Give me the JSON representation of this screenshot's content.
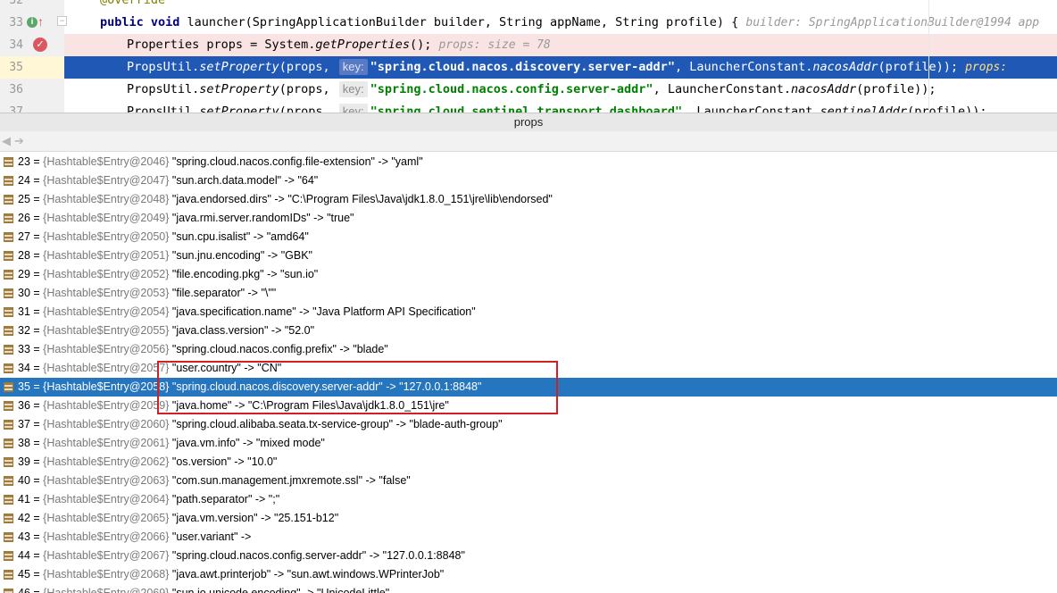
{
  "editor": {
    "lines": [
      {
        "num": "32",
        "text": "@Override"
      },
      {
        "num": "33",
        "kw1": "public void",
        "method": "launcher",
        "params": "(SpringApplicationBuilder builder, String appName, String profile) {",
        "hint": "builder: SpringApplicationBuilder@1994  app"
      },
      {
        "num": "34",
        "pre": "Properties props = System.",
        "call": "getProperties",
        "post": "();",
        "hint": "props:  size = 78"
      },
      {
        "num": "35",
        "pre": "PropsUtil.",
        "call": "setProperty",
        "mid": "(props,",
        "chip": "key:",
        "str": "\"spring.cloud.nacos.discovery.server-addr\"",
        "post": ", LauncherConstant.",
        "call2": "nacosAddr",
        "post2": "(profile));",
        "hint": "props:"
      },
      {
        "num": "36",
        "pre": "PropsUtil.",
        "call": "setProperty",
        "mid": "(props,",
        "chip": "key:",
        "str": "\"spring.cloud.nacos.config.server-addr\"",
        "post": ", LauncherConstant.",
        "call2": "nacosAddr",
        "post2": "(profile));"
      },
      {
        "num": "37",
        "pre": "PropsUtil.",
        "call": "setProperty",
        "mid": "(props,",
        "chip": "key:",
        "str": "\"spring.cloud.sentinel.transport.dashboard\"",
        "post": ", LauncherConstant.",
        "call2": "sentinelAddr",
        "post2": "(profile));"
      }
    ]
  },
  "panel": {
    "title": "props",
    "back_icon": "arrow-left-icon",
    "forward_icon": "arrow-right-icon"
  },
  "entries": [
    {
      "index": "23",
      "ref": "{Hashtable$Entry@2046}",
      "kv": "\"spring.cloud.nacos.config.file-extension\" -> \"yaml\""
    },
    {
      "index": "24",
      "ref": "{Hashtable$Entry@2047}",
      "kv": "\"sun.arch.data.model\" -> \"64\""
    },
    {
      "index": "25",
      "ref": "{Hashtable$Entry@2048}",
      "kv": "\"java.endorsed.dirs\" -> \"C:\\Program Files\\Java\\jdk1.8.0_151\\jre\\lib\\endorsed\""
    },
    {
      "index": "26",
      "ref": "{Hashtable$Entry@2049}",
      "kv": "\"java.rmi.server.randomIDs\" -> \"true\""
    },
    {
      "index": "27",
      "ref": "{Hashtable$Entry@2050}",
      "kv": "\"sun.cpu.isalist\" -> \"amd64\""
    },
    {
      "index": "28",
      "ref": "{Hashtable$Entry@2051}",
      "kv": "\"sun.jnu.encoding\" -> \"GBK\""
    },
    {
      "index": "29",
      "ref": "{Hashtable$Entry@2052}",
      "kv": "\"file.encoding.pkg\" -> \"sun.io\""
    },
    {
      "index": "30",
      "ref": "{Hashtable$Entry@2053}",
      "kv": "\"file.separator\" -> \"\\\"\""
    },
    {
      "index": "31",
      "ref": "{Hashtable$Entry@2054}",
      "kv": "\"java.specification.name\" -> \"Java Platform API Specification\""
    },
    {
      "index": "32",
      "ref": "{Hashtable$Entry@2055}",
      "kv": "\"java.class.version\" -> \"52.0\""
    },
    {
      "index": "33",
      "ref": "{Hashtable$Entry@2056}",
      "kv": "\"spring.cloud.nacos.config.prefix\" -> \"blade\""
    },
    {
      "index": "34",
      "ref": "{Hashtable$Entry@2057}",
      "kv": "\"user.country\" -> \"CN\""
    },
    {
      "index": "35",
      "ref": "{Hashtable$Entry@2058}",
      "kv": "\"spring.cloud.nacos.discovery.server-addr\" -> \"127.0.0.1:8848\""
    },
    {
      "index": "36",
      "ref": "{Hashtable$Entry@2059}",
      "kv": "\"java.home\" -> \"C:\\Program Files\\Java\\jdk1.8.0_151\\jre\""
    },
    {
      "index": "37",
      "ref": "{Hashtable$Entry@2060}",
      "kv": "\"spring.cloud.alibaba.seata.tx-service-group\" -> \"blade-auth-group\""
    },
    {
      "index": "38",
      "ref": "{Hashtable$Entry@2061}",
      "kv": "\"java.vm.info\" -> \"mixed mode\""
    },
    {
      "index": "39",
      "ref": "{Hashtable$Entry@2062}",
      "kv": "\"os.version\" -> \"10.0\""
    },
    {
      "index": "40",
      "ref": "{Hashtable$Entry@2063}",
      "kv": "\"com.sun.management.jmxremote.ssl\" -> \"false\""
    },
    {
      "index": "41",
      "ref": "{Hashtable$Entry@2064}",
      "kv": "\"path.separator\" -> \";\""
    },
    {
      "index": "42",
      "ref": "{Hashtable$Entry@2065}",
      "kv": "\"java.vm.version\" -> \"25.151-b12\""
    },
    {
      "index": "43",
      "ref": "{Hashtable$Entry@2066}",
      "kv": "\"user.variant\" ->"
    },
    {
      "index": "44",
      "ref": "{Hashtable$Entry@2067}",
      "kv": "\"spring.cloud.nacos.config.server-addr\" -> \"127.0.0.1:8848\""
    },
    {
      "index": "45",
      "ref": "{Hashtable$Entry@2068}",
      "kv": "\"java.awt.printerjob\" -> \"sun.awt.windows.WPrinterJob\""
    },
    {
      "index": "46",
      "ref": "{Hashtable$Entry@2069}",
      "kv": "\"sun.io.unicode.encoding\" -> \"UnicodeLittle\""
    }
  ],
  "selected_index": "35",
  "colors": {
    "selection": "#2675bf",
    "current_line": "#2058b6",
    "breakpoint_line": "#fae3e3",
    "annotation_box": "#d21f26"
  }
}
